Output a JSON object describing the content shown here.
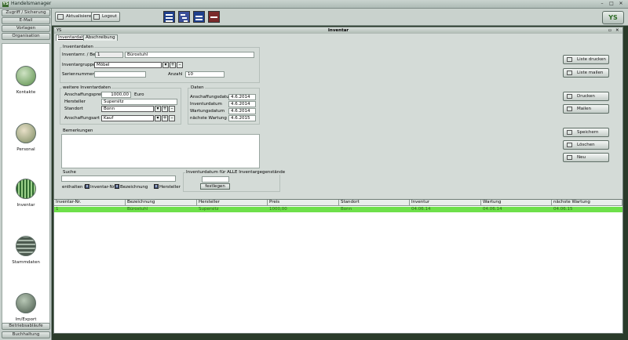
{
  "window": {
    "title": "Handelsmanager",
    "subtitle": ""
  },
  "sidebar": {
    "top_buttons": [
      "Zugriff / Sicherung",
      "E-Mail",
      "Vorlagen",
      "Organisation"
    ],
    "modules": [
      {
        "label": "Kontakte",
        "icon": "contacts-icon",
        "color": "#5a8f4a"
      },
      {
        "label": "Personal",
        "icon": "person-icon",
        "color": "#7a8a60"
      },
      {
        "label": "Inventar",
        "icon": "inventory-icon",
        "color": "#3f7a3f"
      },
      {
        "label": "Stammdaten",
        "icon": "database-icon",
        "color": "#5d6b60"
      },
      {
        "label": "Im/Export",
        "icon": "export-icon",
        "color": "#4a5a4c"
      }
    ],
    "bottom_buttons": [
      "Betriebsabläufe",
      "Buchhaltung"
    ]
  },
  "toolbar": {
    "refresh_label": "Aktualisieren",
    "logout_label": "Logout",
    "logo_text": "YS"
  },
  "inner": {
    "title": "Inventar",
    "corner_label": "YS",
    "tabs": [
      "Inventardaten",
      "Abschreibung"
    ]
  },
  "inventory": {
    "group_label": "Inventardaten",
    "name_label": "Inventarnr. / Bezeichnung",
    "nr_value": "1",
    "bez_value": "Bürostuhl",
    "group_field_label": "Inventargruppe",
    "group_value": "Möbel",
    "serial_label": "Seriennummer",
    "serial_value": "",
    "count_label": "Anzahl",
    "count_value": "10"
  },
  "further": {
    "group_label": "weitere Inventardaten",
    "price_label": "Anschaffungspreis",
    "price_value": "1000,00",
    "currency": "Euro",
    "maker_label": "Hersteller",
    "maker_value": "Supersitz",
    "location_label": "Standort",
    "location_value": "Bonn",
    "acq_type_label": "Anschaffungsart",
    "acq_type_value": "Kauf"
  },
  "dates": {
    "group_label": "Daten",
    "acq_date_label": "Anschaffungsdatum",
    "acq_date_value": "4.6.2014",
    "inv_date_label": "Inventurdatum",
    "inv_date_value": "4.6.2014",
    "maint_date_label": "Wartungsdatum",
    "maint_date_value": "4.6.2014",
    "next_maint_label": "nächste Wartung",
    "next_maint_value": "4.6.2015"
  },
  "remarks": {
    "label": "Bemerkungen",
    "value": ""
  },
  "search": {
    "label": "Suche",
    "value": "",
    "contains_label": "enthalten in",
    "options": [
      "Inventar-Nr.",
      "Bezeichnung",
      "Hersteller"
    ]
  },
  "inventory_date_all": {
    "label": "Inventurdatum für ALLE Inventargegenstände",
    "value": "",
    "button": "festlegen"
  },
  "actions": {
    "print_list": "Liste drucken",
    "mail_list": "Liste mailen",
    "print": "Drucken",
    "mail": "Mailen",
    "save": "Speichern",
    "delete": "Löschen",
    "new": "Neu"
  },
  "table": {
    "columns": [
      "Inventar-Nr.",
      "Bezeichnung",
      "Hersteller",
      "Preis",
      "Standort",
      "Inventur",
      "Wartung",
      "nächste Wartung"
    ],
    "rows": [
      [
        "1",
        "Bürostuhl",
        "Supersitz",
        "1000,00",
        "Bonn",
        "04.06.14",
        "04.06.14",
        "04.06.15"
      ]
    ],
    "highlight_color": "#6ee04a"
  }
}
